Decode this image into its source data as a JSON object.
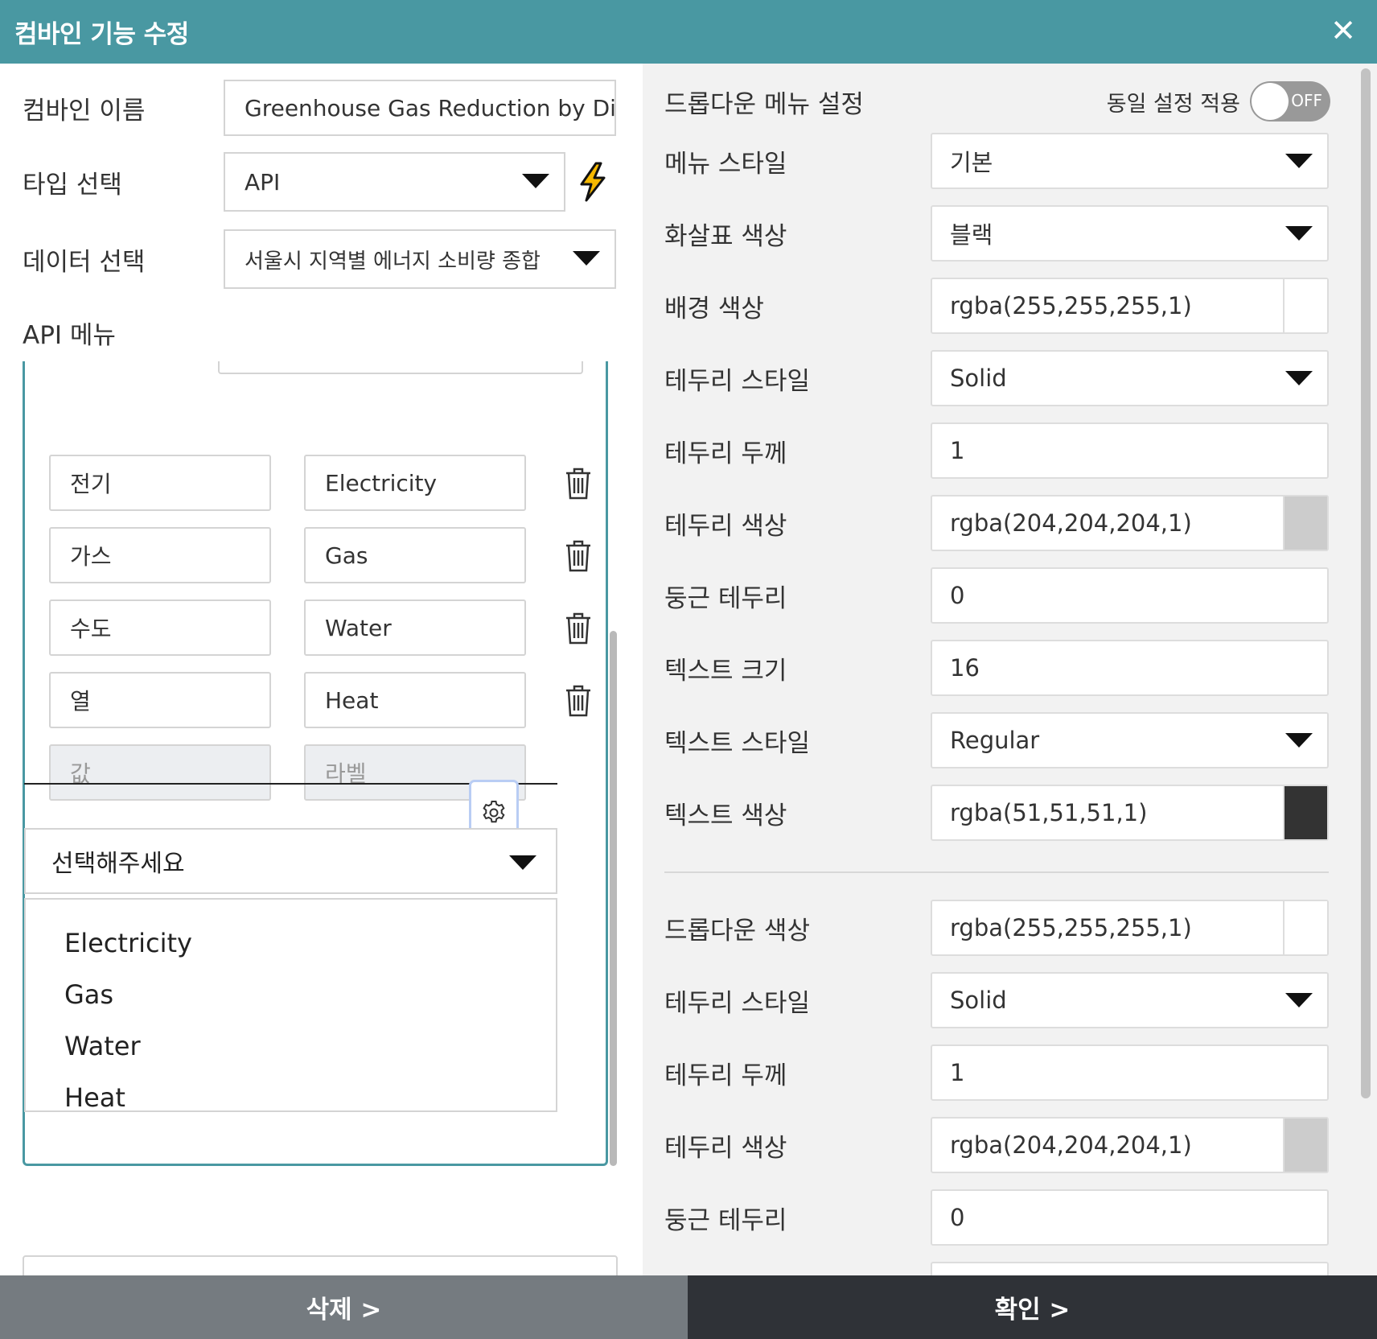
{
  "dialog": {
    "title": "컴바인 기능 수정",
    "close": "✕"
  },
  "form": {
    "name_label": "컴바인 이름",
    "name_value": "Greenhouse Gas Reduction by Dis",
    "type_label": "타입 선택",
    "type_value": "API",
    "data_label": "데이터 선택",
    "data_value": "서울시 지역별 에너지 소비량 종합",
    "api_menu_label": "API 메뉴"
  },
  "api_items": [
    {
      "value": "전기",
      "label": "Electricity"
    },
    {
      "value": "가스",
      "label": "Gas"
    },
    {
      "value": "수도",
      "label": "Water"
    },
    {
      "value": "열",
      "label": "Heat"
    }
  ],
  "api_new": {
    "value_placeholder": "값",
    "label_placeholder": "라벨"
  },
  "preview": {
    "placeholder": "선택해주세요",
    "options": [
      "Electricity",
      "Gas",
      "Water",
      "Heat"
    ]
  },
  "add_button": "+",
  "settings": {
    "header": "드롭다운 메뉴 설정",
    "same_setting_label": "동일 설정 적용",
    "toggle_state": "OFF",
    "rows": [
      {
        "label": "메뉴 스타일",
        "value": "기본",
        "kind": "select"
      },
      {
        "label": "화살표 색상",
        "value": "블랙",
        "kind": "select"
      },
      {
        "label": "배경 색상",
        "value": "rgba(255,255,255,1)",
        "kind": "color",
        "swatch": "#ffffff"
      },
      {
        "label": "테두리 스타일",
        "value": "Solid",
        "kind": "select"
      },
      {
        "label": "테두리 두께",
        "value": "1",
        "kind": "text"
      },
      {
        "label": "테두리 색상",
        "value": "rgba(204,204,204,1)",
        "kind": "color",
        "swatch": "#cccccc"
      },
      {
        "label": "둥근 테두리",
        "value": "0",
        "kind": "text"
      },
      {
        "label": "텍스트 크기",
        "value": "16",
        "kind": "text"
      },
      {
        "label": "텍스트 스타일",
        "value": "Regular",
        "kind": "select"
      },
      {
        "label": "텍스트 색상",
        "value": "rgba(51,51,51,1)",
        "kind": "color",
        "swatch": "#333333"
      }
    ],
    "rows2": [
      {
        "label": "드롭다운 색상",
        "value": "rgba(255,255,255,1)",
        "kind": "color",
        "swatch": "#ffffff"
      },
      {
        "label": "테두리 스타일",
        "value": "Solid",
        "kind": "select"
      },
      {
        "label": "테두리 두께",
        "value": "1",
        "kind": "text"
      },
      {
        "label": "테두리 색상",
        "value": "rgba(204,204,204,1)",
        "kind": "color",
        "swatch": "#cccccc"
      },
      {
        "label": "둥근 테두리",
        "value": "0",
        "kind": "text"
      }
    ]
  },
  "footer": {
    "delete": "삭제 >",
    "confirm": "확인 >"
  },
  "colors": {
    "header_bg": "#4998a2",
    "delete_bg": "#757b80",
    "confirm_bg": "#2f3237",
    "accent": "#4998a2"
  }
}
